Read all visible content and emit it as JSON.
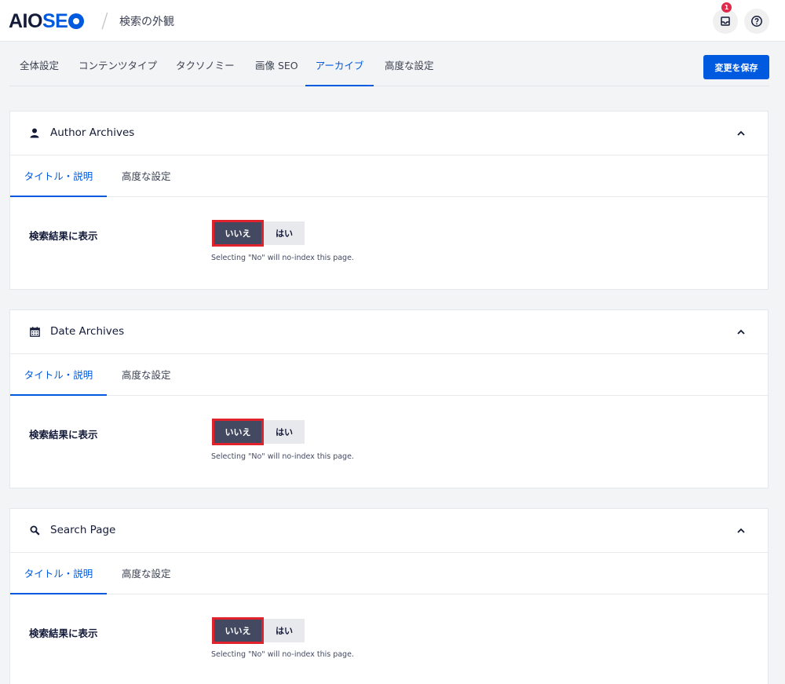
{
  "header": {
    "logo_aio": "AIOSEO",
    "logo_aio_part": "AIO",
    "logo_seo_part": "SE",
    "breadcrumb": "検索の外観",
    "notification_count": "1",
    "icons": [
      "inbox-icon",
      "help-icon"
    ]
  },
  "nav": {
    "tabs": [
      {
        "label": "全体設定"
      },
      {
        "label": "コンテンツタイプ"
      },
      {
        "label": "タクソノミー"
      },
      {
        "label": "画像 SEO"
      },
      {
        "label": "アーカイブ"
      },
      {
        "label": "高度な設定"
      }
    ],
    "active_tab": "アーカイブ",
    "save_label": "変更を保存"
  },
  "cards": [
    {
      "title": "Author Archives",
      "icon": "user-icon",
      "tabs": [
        "タイトル・説明",
        "高度な設定"
      ],
      "field_label": "検索結果に表示",
      "option_no": "いいえ",
      "option_yes": "はい",
      "selected": "いいえ",
      "hint": "Selecting \"No\" will no-index this page."
    },
    {
      "title": "Date Archives",
      "icon": "calendar-icon",
      "tabs": [
        "タイトル・説明",
        "高度な設定"
      ],
      "field_label": "検索結果に表示",
      "option_no": "いいえ",
      "option_yes": "はい",
      "selected": "いいえ",
      "hint": "Selecting \"No\" will no-index this page."
    },
    {
      "title": "Search Page",
      "icon": "search-icon",
      "tabs": [
        "タイトル・説明",
        "高度な設定"
      ],
      "field_label": "検索結果に表示",
      "option_no": "いいえ",
      "option_yes": "はい",
      "selected": "いいえ",
      "hint": "Selecting \"No\" will no-index this page."
    }
  ],
  "colors": {
    "accent": "#005ae0",
    "highlight": "#e0222c",
    "selected_option": "#434960",
    "badge": "#df2a4a"
  }
}
